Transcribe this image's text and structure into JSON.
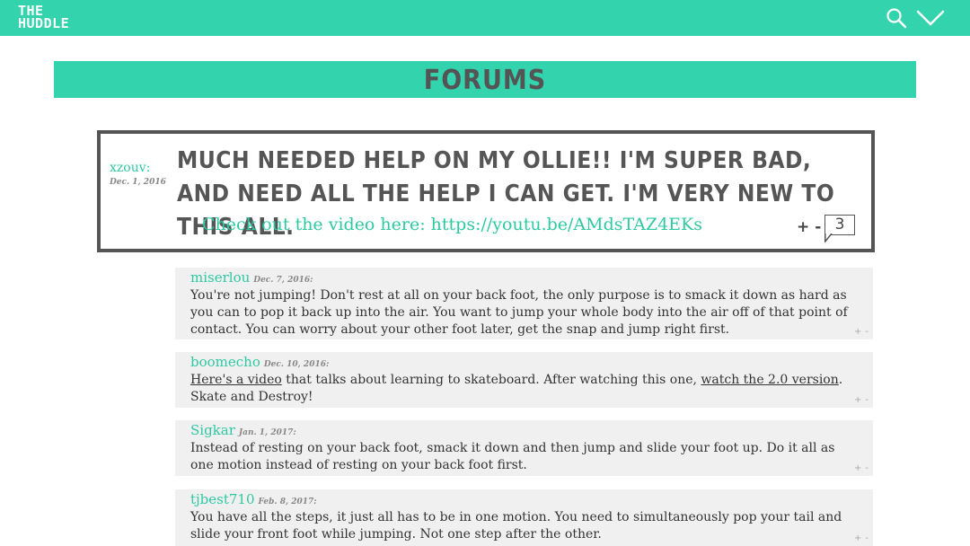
{
  "header": {
    "logo_line1": "THE",
    "logo_line2": "HUDDLE",
    "search_icon": "search-icon",
    "menu_icon": "chevron-down-icon"
  },
  "page": {
    "title": "FORUMS"
  },
  "main_post": {
    "author": "xzouv:",
    "date": "Dec. 1, 2016",
    "title": "Much needed help on my ollie!! I'm super bad, and need all the help I can get. I'm very new to this all.",
    "video_text": "Check out the video here: https://youtu.be/AMdsTAZ4EKs",
    "upvote": "+",
    "downvote": "-",
    "reply_count": "3"
  },
  "replies": [
    {
      "author": "miserlou",
      "date": "Dec. 7, 2016:",
      "body": "You're not jumping! Don't rest at all on your back foot, the only purpose is to smack it down as hard as you can to pop it back up into the air. You want to jump your whole body into the air off of that point of contact. You can worry about your other foot later, get the snap and jump right first.",
      "upvote": "+",
      "downvote": "-"
    },
    {
      "author": "boomecho",
      "date": "Dec. 10, 2016:",
      "link1": "Here's a video",
      "body_mid": " that talks about learning to skateboard. After watching this one, ",
      "link2": "watch the 2.0 version",
      "body_end": ".",
      "body_line2": "Skate and Destroy!",
      "upvote": "+",
      "downvote": "-"
    },
    {
      "author": "Sigkar",
      "date": "Jan. 1, 2017:",
      "body": "Instead of resting on your back foot, smack it down and then jump and slide your foot up. Do it all as one motion instead of resting on your back foot first.",
      "upvote": "+",
      "downvote": "-"
    },
    {
      "author": "tjbest710",
      "date": "Feb. 8, 2017:",
      "body": "You have all the steps, it just all has to be in one motion. You need to simultaneously pop your tail and slide your front foot while jumping. Not one step after the other.",
      "upvote": "+",
      "downvote": "-"
    }
  ],
  "colors": {
    "accent": "#32d3ad",
    "text": "#444444",
    "reply_bg": "#f0f0f0"
  }
}
